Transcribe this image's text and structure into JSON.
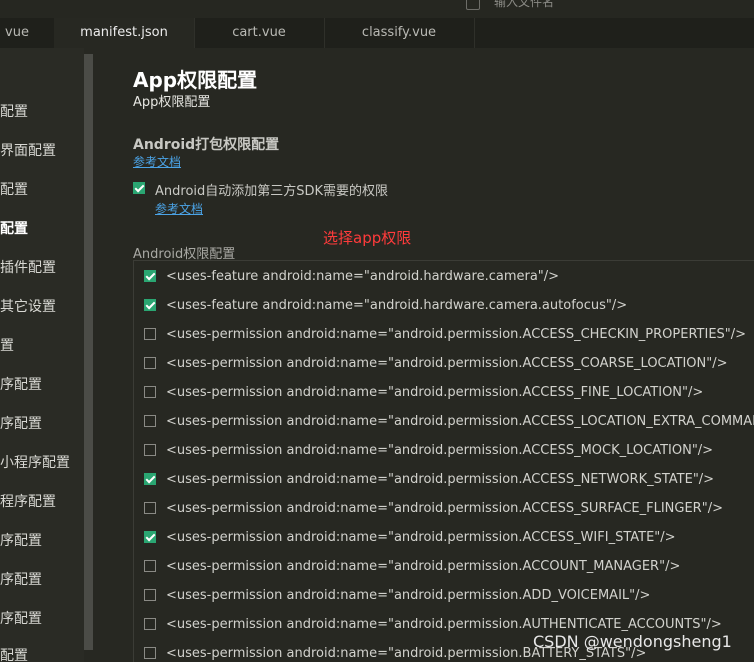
{
  "topbar": {
    "search_placeholder": "输入文件名"
  },
  "tabs": [
    {
      "label": "vue",
      "active": false
    },
    {
      "label": "manifest.json",
      "active": true
    },
    {
      "label": "cart.vue",
      "active": false
    },
    {
      "label": "classify.vue",
      "active": false
    }
  ],
  "sidebar": {
    "items": [
      {
        "label": "配置",
        "bold": false
      },
      {
        "label": "界面配置",
        "bold": false
      },
      {
        "label": "配置",
        "bold": false
      },
      {
        "label": "配置",
        "bold": true
      },
      {
        "label": "插件配置",
        "bold": false
      },
      {
        "label": "其它设置",
        "bold": false
      },
      {
        "label": "置",
        "bold": false
      },
      {
        "label": "序配置",
        "bold": false
      },
      {
        "label": "序配置",
        "bold": false
      },
      {
        "label": "小程序配置",
        "bold": false
      },
      {
        "label": "程序配置",
        "bold": false
      },
      {
        "label": "序配置",
        "bold": false
      },
      {
        "label": "序配置",
        "bold": false
      },
      {
        "label": "序配置",
        "bold": false
      },
      {
        "label": "配置",
        "bold": false
      }
    ]
  },
  "main": {
    "title": "App权限配置",
    "subtitle": "App权限配置",
    "android_section_title": "Android打包权限配置",
    "doc_link": "参考文档",
    "auto_add": {
      "label": "Android自动添加第三方SDK需要的权限",
      "checked": true,
      "doc_link": "参考文档"
    },
    "annotation": "选择app权限",
    "perm_label": "Android权限配置",
    "permissions": [
      {
        "text": "<uses-feature android:name=\"android.hardware.camera\"/>",
        "checked": true
      },
      {
        "text": "<uses-feature android:name=\"android.hardware.camera.autofocus\"/>",
        "checked": true
      },
      {
        "text": "<uses-permission android:name=\"android.permission.ACCESS_CHECKIN_PROPERTIES\"/>",
        "checked": false
      },
      {
        "text": "<uses-permission android:name=\"android.permission.ACCESS_COARSE_LOCATION\"/>",
        "checked": false
      },
      {
        "text": "<uses-permission android:name=\"android.permission.ACCESS_FINE_LOCATION\"/>",
        "checked": false
      },
      {
        "text": "<uses-permission android:name=\"android.permission.ACCESS_LOCATION_EXTRA_COMMANDS",
        "checked": false
      },
      {
        "text": "<uses-permission android:name=\"android.permission.ACCESS_MOCK_LOCATION\"/>",
        "checked": false
      },
      {
        "text": "<uses-permission android:name=\"android.permission.ACCESS_NETWORK_STATE\"/>",
        "checked": true
      },
      {
        "text": "<uses-permission android:name=\"android.permission.ACCESS_SURFACE_FLINGER\"/>",
        "checked": false
      },
      {
        "text": "<uses-permission android:name=\"android.permission.ACCESS_WIFI_STATE\"/>",
        "checked": true
      },
      {
        "text": "<uses-permission android:name=\"android.permission.ACCOUNT_MANAGER\"/>",
        "checked": false
      },
      {
        "text": "<uses-permission android:name=\"android.permission.ADD_VOICEMAIL\"/>",
        "checked": false
      },
      {
        "text": "<uses-permission android:name=\"android.permission.AUTHENTICATE_ACCOUNTS\"/>",
        "checked": false
      },
      {
        "text": "<uses-permission android:name=\"android.permission.BATTERY_STATS\"/>",
        "checked": false
      }
    ]
  },
  "watermark": "CSDN @wendongsheng1",
  "colors": {
    "check_green": "#2aa672",
    "link_blue": "#4ba3e6",
    "annotation_red": "#ff3b3b",
    "bg": "#272822"
  }
}
